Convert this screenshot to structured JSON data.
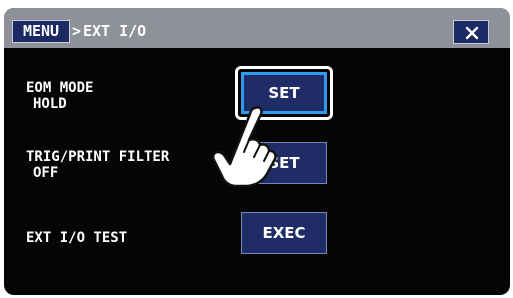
{
  "titlebar": {
    "menu_label": "MENU",
    "separator": ">",
    "breadcrumb": "EXT I/O",
    "close_icon": "close-icon"
  },
  "rows": [
    {
      "label_line1": "EOM MODE",
      "label_line2": "HOLD",
      "button_label": "SET",
      "selected": true
    },
    {
      "label_line1": "TRIG/PRINT FILTER",
      "label_line2": "OFF",
      "button_label": "SET",
      "selected": false
    },
    {
      "label_line1": "EXT I/O TEST",
      "label_line2": "",
      "button_label": "EXEC",
      "selected": false
    }
  ],
  "overlay": {
    "pointer_icon": "pointing-hand-icon"
  },
  "colors": {
    "titlebar_bg": "#8f9199",
    "button_bg": "#1f2c66",
    "selection_border": "#2f9cf2",
    "screen_bg": "#050505"
  }
}
